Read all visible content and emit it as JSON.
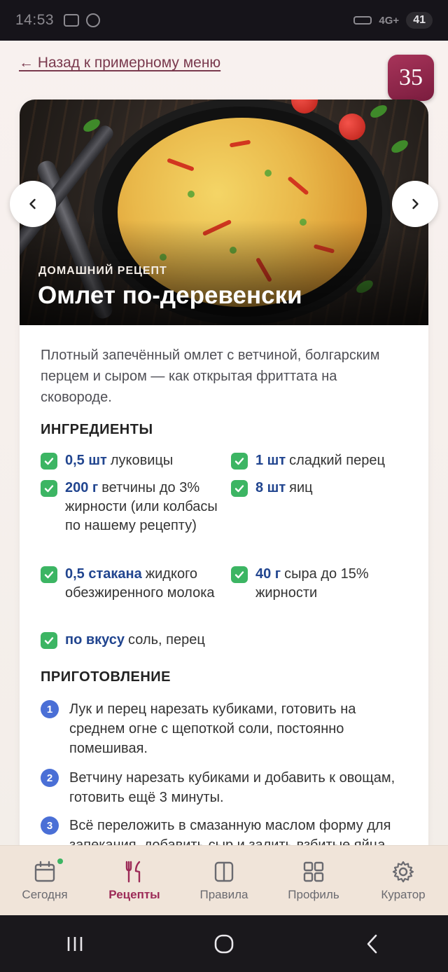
{
  "status_bar": {
    "time": "14:53",
    "network": "4G+",
    "battery": "41"
  },
  "header": {
    "back_link": "← Назад к примерному меню",
    "badge": "35"
  },
  "recipe": {
    "kicker": "ДОМАШНИЙ РЕЦЕПТ",
    "title": "Омлет по-деревенски",
    "description": "Плотный запечённый омлет с ветчиной, болгарским перцем и сыром — как открытая фриттата на сковороде.",
    "ingredients_title": "ИНГРЕДИЕНТЫ",
    "ingredients": [
      {
        "qty": "0,5 шт",
        "name": "луковицы"
      },
      {
        "qty": "1 шт",
        "name": "сладкий перец"
      },
      {
        "qty": "200 г",
        "name": "ветчины до 3% жирности (или колбасы по нашему рецепту)"
      },
      {
        "qty": "8 шт",
        "name": "яиц"
      },
      {
        "qty": "0,5 стакана",
        "name": "жидкого обезжиренного молока"
      },
      {
        "qty": "40 г",
        "name": "сыра до 15% жирности"
      },
      {
        "qty": "по вкусу",
        "name": "соль, перец"
      }
    ],
    "steps_title": "ПРИГОТОВЛЕНИЕ",
    "steps": [
      {
        "num": "1",
        "text": "Лук и перец нарезать кубиками, готовить на среднем огне с щепоткой соли, постоянно помешивая."
      },
      {
        "num": "2",
        "text": "Ветчину нарезать кубиками и добавить к овощам, готовить ещё 3 минуты."
      },
      {
        "num": "3",
        "text": "Всё переложить в смазанную маслом форму для запекания, добавить сыр и залить взбитые яйца"
      }
    ]
  },
  "tabs": [
    {
      "label": "Сегодня",
      "icon": "calendar-icon"
    },
    {
      "label": "Рецепты",
      "icon": "fork-knife-icon",
      "active": true
    },
    {
      "label": "Правила",
      "icon": "book-icon"
    },
    {
      "label": "Профиль",
      "icon": "grid-icon"
    },
    {
      "label": "Куратор",
      "icon": "gear-icon"
    }
  ],
  "colors": {
    "accent": "#9c2a57",
    "quantity": "#21458f",
    "check": "#3cb563",
    "step_number": "#4a6fd6"
  }
}
